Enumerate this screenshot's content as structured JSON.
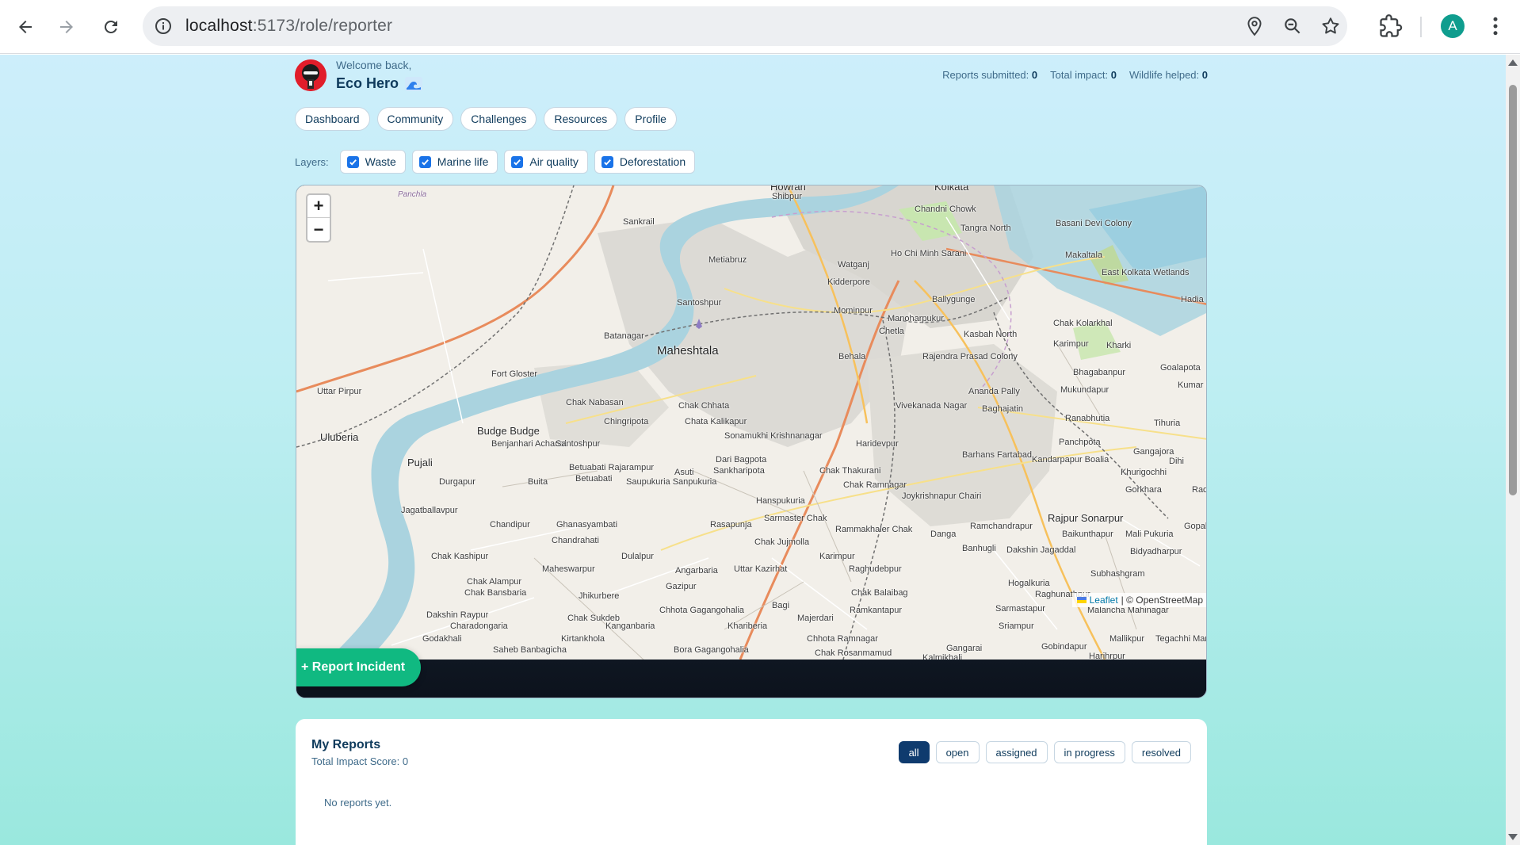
{
  "browser": {
    "url_host": "localhost",
    "url_path": ":5173/role/reporter",
    "profile_initial": "A"
  },
  "header": {
    "welcome": "Welcome back,",
    "username": "Eco Hero",
    "stats": [
      {
        "label": "Reports submitted:",
        "value": "0"
      },
      {
        "label": "Total impact:",
        "value": "0"
      },
      {
        "label": "Wildlife helped:",
        "value": "0"
      }
    ]
  },
  "tabs": [
    "Dashboard",
    "Community",
    "Challenges",
    "Resources",
    "Profile"
  ],
  "layers": {
    "label": "Layers:",
    "items": [
      {
        "label": "Waste",
        "checked": true
      },
      {
        "label": "Marine life",
        "checked": true
      },
      {
        "label": "Air quality",
        "checked": true
      },
      {
        "label": "Deforestation",
        "checked": true
      }
    ]
  },
  "map": {
    "zoom_in": "+",
    "zoom_out": "−",
    "attribution_leaflet": "Leaflet",
    "attribution_osm": "| © OpenStreetMap",
    "report_button": "+ Report Incident",
    "places": [
      "Howrah",
      "Kolkata",
      "Shibpur",
      "Panchla",
      "Sankrail",
      "Chandni Chowk",
      "Tangra North",
      "Basani Devi Colony",
      "Metiabruz",
      "Ho Chi Minh Sarani",
      "Makaltala",
      "Watganj",
      "East Kolkata Wetlands",
      "Kidderpore",
      "Hadia",
      "Santoshpur",
      "Ballygunge",
      "Mominpur",
      "Manoharpukur",
      "Chak Kolarkhal",
      "Chetla",
      "Kasbah North",
      "Batanagar",
      "Karimpur",
      "Kharki",
      "Maheshtala",
      "Behala",
      "Rajendra Prasad Colony",
      "Goalapota",
      "Bhagabanpur",
      "Fort Gloster",
      "Kumar Pu",
      "Uttar Pirpur",
      "Ananda Pally",
      "Mukundapur",
      "Chak Nabasan",
      "Vivekanada Nagar",
      "Baghajatin",
      "Chak Chhata",
      "Ranabhutia",
      "Chingripota",
      "Chata Kalikapur",
      "Tihuria",
      "Uluberia",
      "Budge Budge",
      "Sonamukhi Krishnanagar",
      "Haridevpur",
      "Panchpota",
      "Benjanhari Acharial",
      "Santoshpur",
      "Barhans Fartabad",
      "Gangajora",
      "Pujali",
      "Dari Bagpota",
      "Kandarpapur Boalia",
      "Dihi",
      "Betuabati Rajarampur",
      "Asuti",
      "Sankharipota",
      "Chak Thakurani",
      "Khurigochhi",
      "Durgapur",
      "Buita",
      "Betuabati",
      "Saupukuria Sanpukuria",
      "Chak Ramnagar",
      "Gorkhara",
      "Radhan",
      "Hanspukuria",
      "Joykrishnapur Chairi",
      "Jagatballavpur",
      "Rajpur Sonarpur",
      "Chandipur",
      "Ghanasyambati",
      "Rasapunja",
      "Sarmaster Chak",
      "Ramchandrapur",
      "Baikunthapur",
      "Gopal P",
      "Rammakhaler Chak",
      "Danga",
      "Mali Pukuria",
      "Chandrahati",
      "Chak Jujmolla",
      "Banhugli",
      "Dakshin Jagaddal",
      "Bidyadharpur",
      "Chak Kashipur",
      "Dulalpur",
      "Karimpur",
      "Maheswarpur",
      "Angarbaria",
      "Uttar Kazirhat",
      "Raghudebpur",
      "Subhashgram",
      "Chak Alampur",
      "Gazipur",
      "Hogalkuria",
      "Chak Bansbaria",
      "Jhikurbere",
      "Chak Balaibag",
      "Raghunathpur",
      "Bagi",
      "Chhota Gagangohalia",
      "Ramkantapur",
      "Sarmastapur",
      "Malancha Mahinagar",
      "Dakshin Raypur",
      "Chak Sukdeb",
      "Majerdari",
      "Charadongaria",
      "Kanganbaria",
      "Khariberia",
      "Sriampur",
      "Godakhali",
      "Kirtankhola",
      "Chhota Ramnagar",
      "Mallikpur",
      "Tegachhi Mar",
      "Saheb Banbagicha",
      "Bora Gagangohalia",
      "Gangarai",
      "Gobindapur",
      "Chak Rosanmamud",
      "Kalmikhali",
      "Harihrpur"
    ]
  },
  "reports": {
    "title": "My Reports",
    "subtitle": "Total Impact Score: 0",
    "filters": [
      "all",
      "open",
      "assigned",
      "in progress",
      "resolved"
    ],
    "active_filter": "all",
    "empty_text": "No reports yet."
  },
  "colors": {
    "accent": "#10b981",
    "primary_dark": "#0f3b6e",
    "text": "#0f3b5c",
    "river": "#aad3df",
    "checkbox": "#1a73e8"
  }
}
